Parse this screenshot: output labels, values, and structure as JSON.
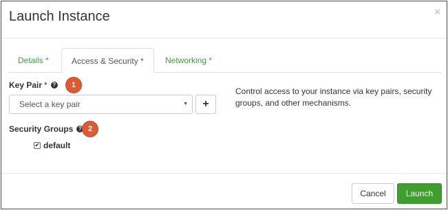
{
  "modal": {
    "title": "Launch Instance",
    "close_symbol": "×"
  },
  "tabs": [
    {
      "label": "Details *",
      "active": false
    },
    {
      "label": "Access & Security *",
      "active": true
    },
    {
      "label": "Networking *",
      "active": false
    }
  ],
  "key_pair": {
    "label": "Key Pair",
    "required_mark": "*",
    "help_icon": "question-circle-icon",
    "badge": "1",
    "select_value": "Select a key pair",
    "add_symbol": "+"
  },
  "help_text": "Control access to your instance via key pairs, security groups, and other mechanisms.",
  "security_groups": {
    "label": "Security Groups",
    "help_icon": "question-circle-icon",
    "badge": "2",
    "options": [
      {
        "label": "default",
        "checked": true
      }
    ]
  },
  "footer": {
    "cancel_label": "Cancel",
    "launch_label": "Launch"
  },
  "colors": {
    "tab_inactive": "#3e9c3e",
    "launch_button": "#3f9f2e",
    "badge": "#dd5a33"
  }
}
